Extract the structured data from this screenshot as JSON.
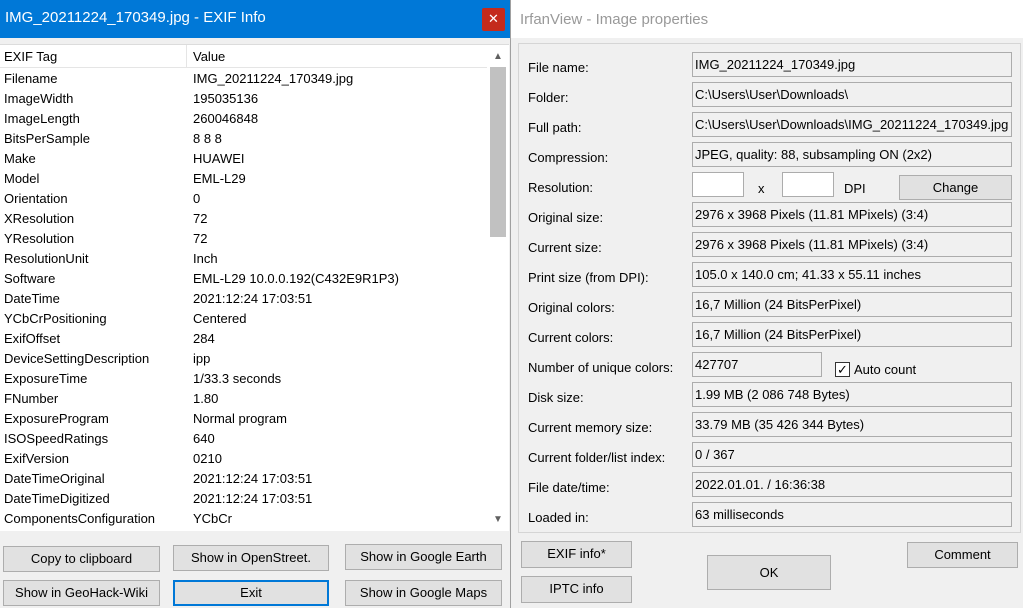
{
  "exif_window": {
    "title": "IMG_20211224_170349.jpg - EXIF Info",
    "close_glyph": "✕",
    "columns": {
      "tag": "EXIF Tag",
      "value": "Value"
    },
    "rows": [
      {
        "tag": "Filename",
        "value": "IMG_20211224_170349.jpg"
      },
      {
        "tag": "ImageWidth",
        "value": "195035136"
      },
      {
        "tag": "ImageLength",
        "value": "260046848"
      },
      {
        "tag": "BitsPerSample",
        "value": "8 8 8"
      },
      {
        "tag": "Make",
        "value": "HUAWEI"
      },
      {
        "tag": "Model",
        "value": "EML-L29"
      },
      {
        "tag": "Orientation",
        "value": "0"
      },
      {
        "tag": "XResolution",
        "value": "72"
      },
      {
        "tag": "YResolution",
        "value": "72"
      },
      {
        "tag": "ResolutionUnit",
        "value": "Inch"
      },
      {
        "tag": "Software",
        "value": "EML-L29 10.0.0.192(C432E9R1P3)"
      },
      {
        "tag": "DateTime",
        "value": "2021:12:24 17:03:51"
      },
      {
        "tag": "YCbCrPositioning",
        "value": "Centered"
      },
      {
        "tag": "ExifOffset",
        "value": "284"
      },
      {
        "tag": "DeviceSettingDescription",
        "value": "ipp"
      },
      {
        "tag": "ExposureTime",
        "value": "1/33.3 seconds"
      },
      {
        "tag": "FNumber",
        "value": "1.80"
      },
      {
        "tag": "ExposureProgram",
        "value": "Normal program"
      },
      {
        "tag": "ISOSpeedRatings",
        "value": "640"
      },
      {
        "tag": "ExifVersion",
        "value": "0210"
      },
      {
        "tag": "DateTimeOriginal",
        "value": "2021:12:24 17:03:51"
      },
      {
        "tag": "DateTimeDigitized",
        "value": "2021:12:24 17:03:51"
      },
      {
        "tag": "ComponentsConfiguration",
        "value": "YCbCr"
      }
    ],
    "buttons": {
      "copy": "Copy to clipboard",
      "openstreet": "Show in OpenStreet.",
      "google_earth": "Show in Google Earth",
      "geohack": "Show in GeoHack-Wiki",
      "exit": "Exit",
      "google_maps": "Show in Google Maps"
    },
    "scroll_up_glyph": "▲",
    "scroll_down_glyph": "▼"
  },
  "props_window": {
    "title": "IrfanView - Image properties",
    "file_name": {
      "label": "File name:",
      "value": "IMG_20211224_170349.jpg"
    },
    "folder": {
      "label": "Folder:",
      "value": "C:\\Users\\User\\Downloads\\"
    },
    "full_path": {
      "label": "Full path:",
      "value": "C:\\Users\\User\\Downloads\\IMG_20211224_170349.jpg"
    },
    "compression": {
      "label": "Compression:",
      "value": "JPEG, quality: 88, subsampling ON (2x2)"
    },
    "resolution": {
      "label": "Resolution:",
      "x_value": "",
      "y_value": "",
      "separator": "x",
      "unit": "DPI",
      "change_button": "Change"
    },
    "original_size": {
      "label": "Original size:",
      "value": "2976 x 3968  Pixels (11.81 MPixels) (3:4)"
    },
    "current_size": {
      "label": "Current size:",
      "value": "2976 x 3968  Pixels (11.81 MPixels) (3:4)"
    },
    "print_size": {
      "label": "Print size (from DPI):",
      "value": "105.0 x 140.0 cm; 41.33 x 55.11 inches"
    },
    "original_colors": {
      "label": "Original colors:",
      "value": "16,7 Million   (24 BitsPerPixel)"
    },
    "current_colors": {
      "label": "Current colors:",
      "value": "16,7 Million   (24 BitsPerPixel)"
    },
    "unique_colors": {
      "label": "Number of unique colors:",
      "value": "427707",
      "auto_count_label": "Auto count",
      "auto_count_checked": true,
      "check_glyph": "✓"
    },
    "disk_size": {
      "label": "Disk size:",
      "value": "1.99 MB (2 086 748 Bytes)"
    },
    "memory_size": {
      "label": "Current memory size:",
      "value": "33.79  MB (35 426 344 Bytes)"
    },
    "folder_index": {
      "label": "Current folder/list index:",
      "value": "0  /  367"
    },
    "file_date": {
      "label": "File date/time:",
      "value": "2022.01.01. / 16:36:38"
    },
    "loaded_in": {
      "label": "Loaded in:",
      "value": "63 milliseconds"
    },
    "buttons": {
      "exif_info": "EXIF info*",
      "iptc_info": "IPTC info",
      "ok": "OK",
      "comment": "Comment"
    }
  }
}
